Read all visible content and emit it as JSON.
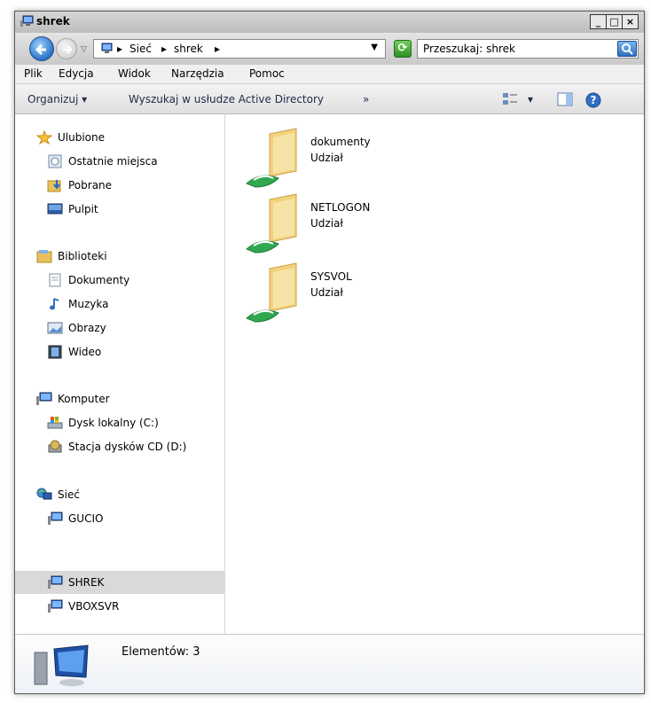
{
  "window": {
    "title": "shrek"
  },
  "window_buttons": {
    "minimize": "_",
    "maximize": "□",
    "close": "×"
  },
  "address": {
    "crumbs": [
      "Sieć",
      "shrek"
    ],
    "refresh_icon": "refresh-arrows"
  },
  "search": {
    "text": "Przeszukaj: shrek"
  },
  "menu": [
    {
      "label": "Plik"
    },
    {
      "label": "Edycja"
    },
    {
      "label": "Widok"
    },
    {
      "label": "Narzędzia"
    },
    {
      "label": "Pomoc"
    }
  ],
  "toolbar": {
    "organize": "Organizuj",
    "search_ad": "Wyszukaj w usłudze Active Directory",
    "more": "»"
  },
  "sidebar": {
    "favorites": "Ulubione",
    "recent": "Ostatnie miejsca",
    "downloads": "Pobrane",
    "desktop": "Pulpit",
    "libraries": "Biblioteki",
    "documents": "Dokumenty",
    "music": "Muzyka",
    "pictures": "Obrazy",
    "video": "Wideo",
    "computer": "Komputer",
    "local_disk": "Dysk lokalny (C:)",
    "cd_drive": "Stacja dysków CD (D:)",
    "network": "Sieć",
    "net_gucio": "GUCIO",
    "net_shrek": "SHREK",
    "net_vboxsvr": "VBOXSVR"
  },
  "shares": [
    {
      "name": "dokumenty",
      "type": "Udział"
    },
    {
      "name": "NETLOGON",
      "type": "Udział"
    },
    {
      "name": "SYSVOL",
      "type": "Udział"
    }
  ],
  "status": {
    "text": "Elementów: 3"
  },
  "colors": {
    "selection": "#d9d9d9",
    "link_text": "#1e2b48",
    "folder": "#f2d27a"
  }
}
